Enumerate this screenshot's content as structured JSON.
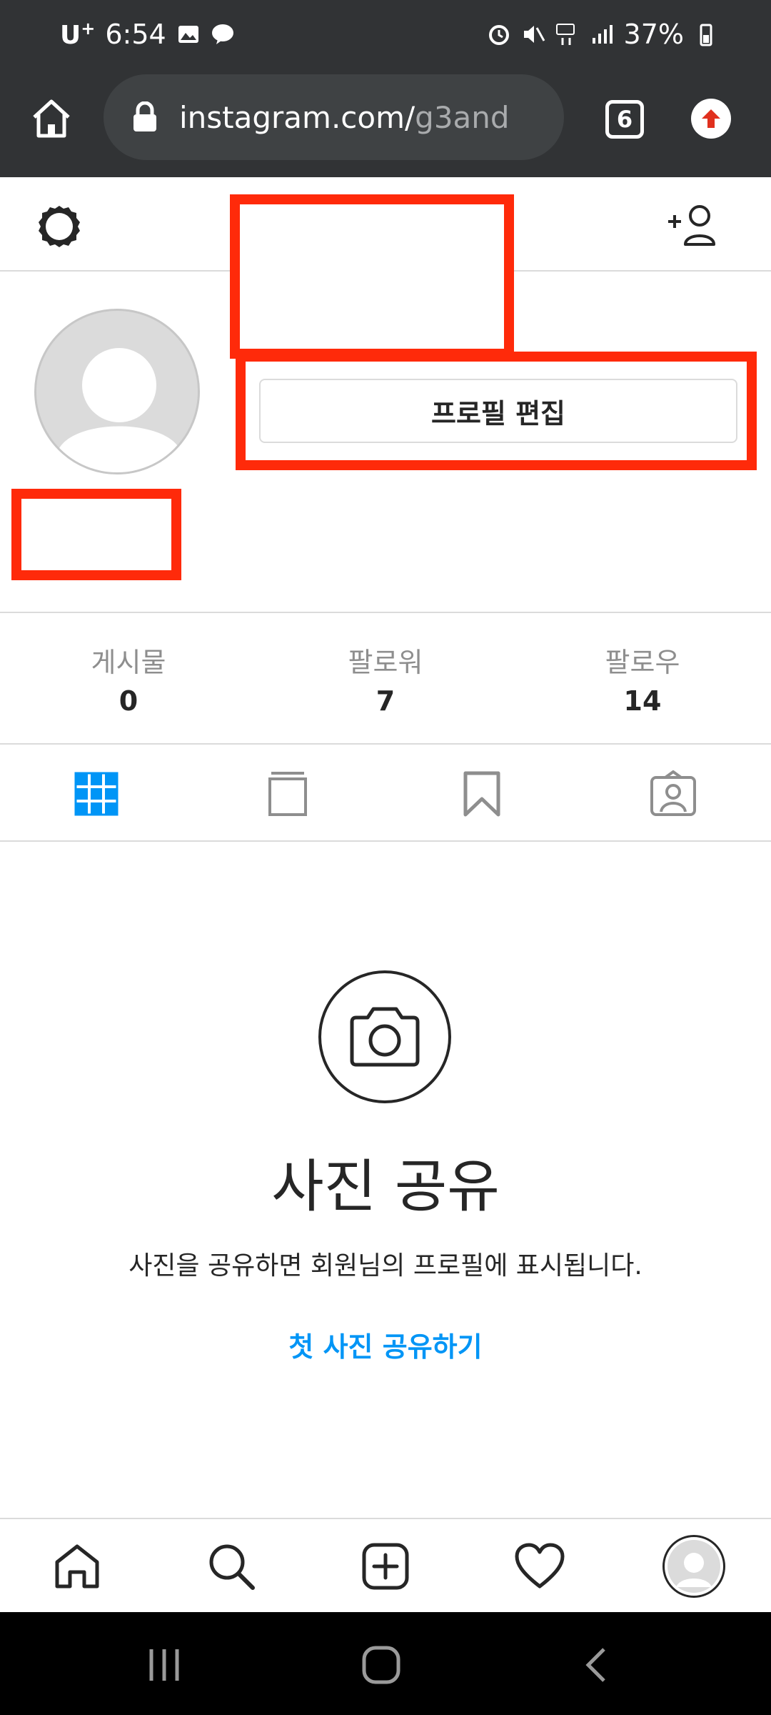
{
  "status_bar": {
    "carrier": "U",
    "carrier_sup": "+",
    "time": "6:54",
    "battery": "37%"
  },
  "browser": {
    "url_domain": "instagram.com/",
    "url_path": "g3and",
    "tab_count": "6"
  },
  "profile": {
    "edit_button_label": "프로필 편집"
  },
  "stats": [
    {
      "label": "게시물",
      "value": "0"
    },
    {
      "label": "팔로워",
      "value": "7"
    },
    {
      "label": "팔로우",
      "value": "14"
    }
  ],
  "empty_state": {
    "title": "사진 공유",
    "description": "사진을 공유하면 회원님의 프로필에 표시됩니다.",
    "cta": "첫 사진 공유하기"
  },
  "colors": {
    "accent": "#0095f6",
    "redaction": "#ff2a0a",
    "chrome": "#313335"
  },
  "icons": [
    "home-icon",
    "lock-icon",
    "tabs-icon",
    "update-icon",
    "settings-icon",
    "add-person-icon",
    "grid-icon",
    "igtv-icon",
    "saved-icon",
    "tagged-icon",
    "camera-icon",
    "search-icon",
    "new-post-icon",
    "heart-icon"
  ]
}
